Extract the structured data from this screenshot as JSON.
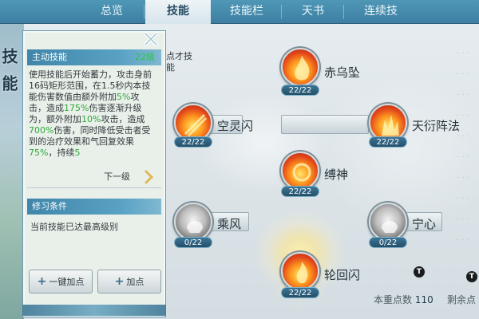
{
  "side_title": "技能",
  "tabs": [
    {
      "label": "总览",
      "active": false
    },
    {
      "label": "技能",
      "active": true
    },
    {
      "label": "技能栏",
      "active": false
    },
    {
      "label": "天书",
      "active": false
    },
    {
      "label": "连续技",
      "active": false
    }
  ],
  "detail": {
    "type_label": "主动技能",
    "level_label": "22级",
    "description_parts": [
      {
        "text": "使用技能后开始蓄力，攻击身前16码矩形范围，在1.5秒内本技能伤害数值由额外附加",
        "hl": false
      },
      {
        "text": "5%",
        "hl": true
      },
      {
        "text": "攻击，造成",
        "hl": false
      },
      {
        "text": "175%",
        "hl": true
      },
      {
        "text": "伤害逐渐升级为，额外附加",
        "hl": false
      },
      {
        "text": "10%",
        "hl": true
      },
      {
        "text": "攻击，造成",
        "hl": false
      },
      {
        "text": "700%",
        "hl": true
      },
      {
        "text": "伤害，同时降低受击者受到的治疗效果和气回复效果",
        "hl": false
      },
      {
        "text": "75%",
        "hl": true
      },
      {
        "text": "，持续",
        "hl": false
      },
      {
        "text": "5",
        "hl": true
      }
    ],
    "next_level_label": "下一级",
    "requirement_header": "修习条件",
    "requirement_text": "当前技能已达最高级别",
    "btn_one_click": "一键加点",
    "btn_add": "加点"
  },
  "hint_text": "点才技能",
  "skills": [
    {
      "name": "赤乌坠",
      "count": "22/22",
      "style": "fire"
    },
    {
      "name": "空灵闪",
      "count": "22/22",
      "style": "fire"
    },
    {
      "name": "天衍阵法",
      "count": "22/22",
      "style": "fire"
    },
    {
      "name": "缚神",
      "count": "22/22",
      "style": "fire"
    },
    {
      "name": "乘风",
      "count": "0/22",
      "style": "gray"
    },
    {
      "name": "宁心",
      "count": "0/22",
      "style": "gray"
    },
    {
      "name": "轮回闪",
      "count": "22/22",
      "style": "fire"
    }
  ],
  "footer": {
    "points_label": "本重点数",
    "points_value": "110",
    "remaining_label": "剩余点"
  },
  "colors": {
    "tab_bar": "#3d7fa2",
    "highlight_green": "#2fa83b",
    "section_header": "#3f86aa"
  }
}
